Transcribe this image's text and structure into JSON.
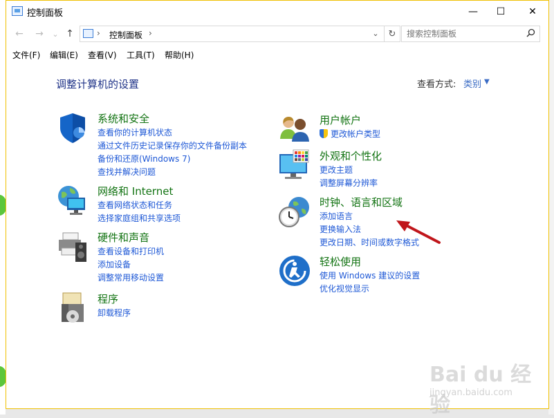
{
  "window": {
    "title": "控制面板",
    "minimize_symbol": "—",
    "maximize_symbol": "☐",
    "close_symbol": "✕"
  },
  "nav": {
    "back_symbol": "←",
    "forward_symbol": "→",
    "recent_symbol": "⌄",
    "up_symbol": "↑"
  },
  "address": {
    "separator": "›",
    "crumb": "控制面板",
    "crumb_separator": "›",
    "dropdown_symbol": "⌄",
    "refresh_symbol": "↻"
  },
  "search": {
    "placeholder": "搜索控制面板"
  },
  "menu": [
    "文件(F)",
    "编辑(E)",
    "查看(V)",
    "工具(T)",
    "帮助(H)"
  ],
  "content": {
    "title": "调整计算机的设置",
    "view_by_label": "查看方式:",
    "view_by_value": "类别",
    "view_by_caret": "▼"
  },
  "categories_left": [
    {
      "name": "系统和安全",
      "icon": "shield-icon",
      "links": [
        "查看你的计算机状态",
        "通过文件历史记录保存你的文件备份副本",
        "备份和还原(Windows 7)",
        "查找并解决问题"
      ]
    },
    {
      "name": "网络和 Internet",
      "icon": "network-globe-icon",
      "links": [
        "查看网络状态和任务",
        "选择家庭组和共享选项"
      ]
    },
    {
      "name": "硬件和声音",
      "icon": "printer-speaker-icon",
      "links": [
        "查看设备和打印机",
        "添加设备",
        "调整常用移动设置"
      ]
    },
    {
      "name": "程序",
      "icon": "programs-disc-icon",
      "links": [
        "卸载程序"
      ]
    }
  ],
  "categories_right": [
    {
      "name": "用户帐户",
      "icon": "users-icon",
      "links": [
        "更改帐户类型"
      ]
    },
    {
      "name": "外观和个性化",
      "icon": "monitor-palette-icon",
      "links": [
        "更改主题",
        "调整屏幕分辨率"
      ]
    },
    {
      "name": "时钟、语言和区域",
      "icon": "clock-globe-icon",
      "links": [
        "添加语言",
        "更换输入法",
        "更改日期、时间或数字格式"
      ]
    },
    {
      "name": "轻松使用",
      "icon": "ease-of-access-icon",
      "links": [
        "使用 Windows 建议的设置",
        "优化视觉显示"
      ]
    }
  ],
  "watermark": {
    "brand": "Bai du 经验",
    "url": "jingyan.baidu.com"
  },
  "colors": {
    "heading_green": "#127312",
    "link_blue": "#1e58d6",
    "title_blue": "#1e3287",
    "annotation_arrow": "#c0161b"
  }
}
